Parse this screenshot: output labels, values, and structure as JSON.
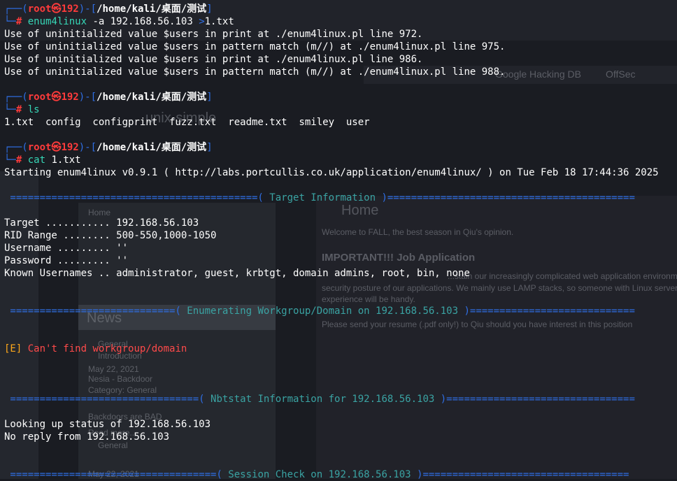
{
  "prompt": {
    "user": "root",
    "skull": "㉿",
    "host": "192",
    "path": "/home/kali/桌面/测试",
    "symbol": "#"
  },
  "commands": {
    "cmd1": {
      "bin": "enum4linux",
      "args": " -a 192.168.56.103 ",
      "redir": ">",
      "target": "1.txt"
    },
    "cmd2": {
      "bin": "ls"
    },
    "cmd3": {
      "bin": "cat",
      "arg": "1.txt"
    }
  },
  "output1": [
    "Use of uninitialized value $users in print at ./enum4linux.pl line 972.",
    "Use of uninitialized value $users in pattern match (m//) at ./enum4linux.pl line 975.",
    "Use of uninitialized value $users in print at ./enum4linux.pl line 986.",
    "Use of uninitialized value $users in pattern match (m//) at ./enum4linux.pl line 988."
  ],
  "ls_output": "1.txt  config  configprint  fuzz.txt  readme.txt  smiley  user",
  "cat": {
    "starting": "Starting enum4linux v0.9.1 ( http://labs.portcullis.co.uk/application/enum4linux/ ) on Tue Feb 18 17:44:36 2025",
    "sec1": {
      "left": " ==========================================( ",
      "title": "Target Information",
      "right": " )=========================================="
    },
    "target_info": [
      "Target ........... 192.168.56.103",
      "RID Range ........ 500-550,1000-1050",
      "Username ......... ''",
      "Password ......... ''",
      "Known Usernames .. administrator, guest, krbtgt, domain admins, root, bin, none"
    ],
    "sec2": {
      "left": " ============================( ",
      "title": "Enumerating Workgroup/Domain on 192.168.56.103",
      "right": " )============================"
    },
    "err_tag": "[E]",
    "err_msg": " Can't find workgroup/domain",
    "sec3": {
      "left": " ================================( ",
      "title": "Nbtstat Information for 192.168.56.103",
      "right": " )================================"
    },
    "nbt_lines": [
      "Looking up status of 192.168.56.103",
      "No reply from 192.168.56.103"
    ],
    "sec4": {
      "left": " ===================================( ",
      "title": "Session Check on 192.168.56.103",
      "right": " )==================================="
    }
  },
  "background_page": {
    "links": [
      "Google Hacking DB",
      "OffSec"
    ],
    "logo": "unix-simple",
    "breadcrumb": "Home",
    "home_title": "Home",
    "welcome": "Welcome to FALL, the best season in Qiu's opinion.",
    "important": "IMPORTANT!!! Job Application",
    "body1": "...stain our increasingly complicated web application environm...",
    "body2": "security posture of our applications. We mainly use LAMP stacks, so someone with Linux server",
    "body3": "experience will be handy.",
    "body4": "Please send your resume (.pdf only!) to Qiu should you have interest in this position",
    "news": "News",
    "news_items": [
      "General",
      "Introduction",
      "May 22, 2021",
      "Nesia - Backdoor",
      "Category: General",
      "Backdoors are BAD",
      "Read more...",
      "General",
      "May 22, 2021"
    ]
  }
}
